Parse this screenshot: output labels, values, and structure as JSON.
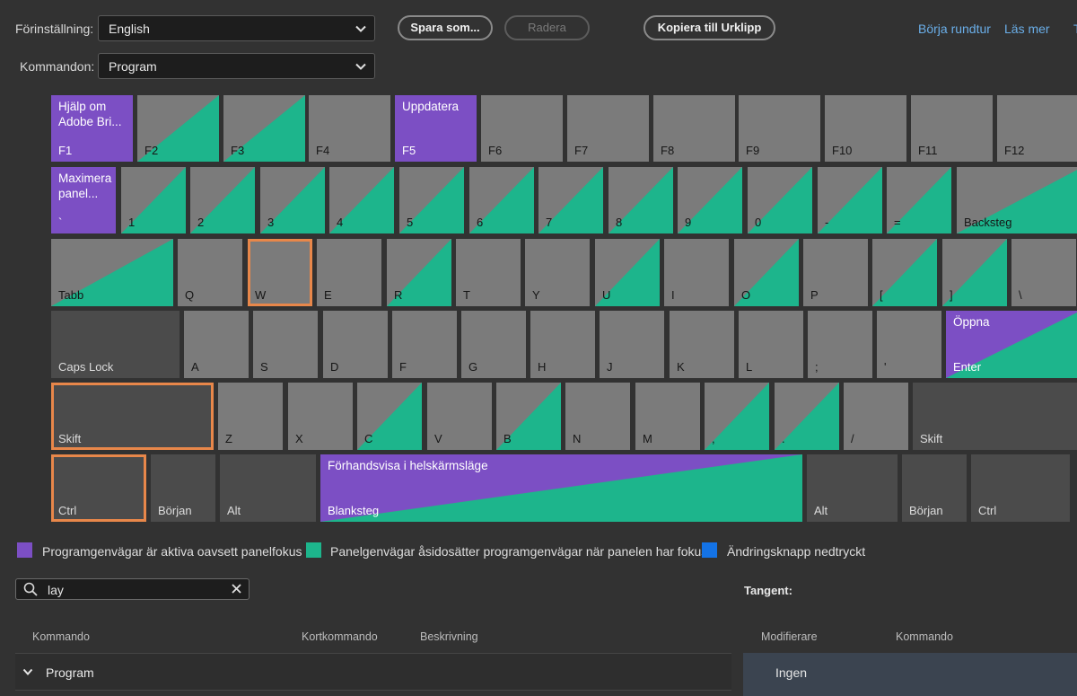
{
  "toolbar": {
    "preset_label": "Förinställning:",
    "preset_value": "English",
    "commands_label": "Kommandon:",
    "commands_value": "Program",
    "save_as": "Spara som...",
    "delete": "Radera",
    "copy": "Kopiera till Urklipp",
    "tour": "Börja rundtur",
    "learn_more": "Läs mer",
    "truncated": "T"
  },
  "colors": {
    "app_shortcut": "#7c4fc4",
    "panel_shortcut": "#1db58c",
    "modifier": "#1473e6",
    "selected_outline": "#e8874a"
  },
  "keyboard": [
    [
      {
        "label": "F1",
        "type": "purple",
        "cmd": "Hjälp om Adobe Bri..."
      },
      {
        "label": "F2",
        "type": "teal"
      },
      {
        "label": "F3",
        "type": "teal"
      },
      {
        "label": "F4",
        "type": "plain"
      },
      {
        "label": "F5",
        "type": "purple",
        "cmd": "Uppdatera"
      },
      {
        "label": "F6",
        "type": "plain"
      },
      {
        "label": "F7",
        "type": "plain"
      },
      {
        "label": "F8",
        "type": "plain"
      },
      {
        "label": "F9",
        "type": "plain"
      },
      {
        "label": "F10",
        "type": "plain"
      },
      {
        "label": "F11",
        "type": "plain"
      },
      {
        "label": "F12",
        "type": "plain"
      }
    ],
    [
      {
        "label": "`",
        "type": "purple",
        "cmd": "Maximera panel..."
      },
      {
        "label": "1",
        "type": "teal"
      },
      {
        "label": "2",
        "type": "teal"
      },
      {
        "label": "3",
        "type": "teal"
      },
      {
        "label": "4",
        "type": "teal"
      },
      {
        "label": "5",
        "type": "teal"
      },
      {
        "label": "6",
        "type": "teal"
      },
      {
        "label": "7",
        "type": "teal"
      },
      {
        "label": "8",
        "type": "teal"
      },
      {
        "label": "9",
        "type": "teal"
      },
      {
        "label": "0",
        "type": "teal"
      },
      {
        "label": "-",
        "type": "teal"
      },
      {
        "label": "=",
        "type": "teal"
      },
      {
        "label": "Backsteg",
        "type": "teal"
      }
    ],
    [
      {
        "label": "Tabb",
        "type": "teal"
      },
      {
        "label": "Q",
        "type": "plain"
      },
      {
        "label": "W",
        "type": "plain",
        "selected": true
      },
      {
        "label": "E",
        "type": "plain"
      },
      {
        "label": "R",
        "type": "teal"
      },
      {
        "label": "T",
        "type": "plain"
      },
      {
        "label": "Y",
        "type": "plain"
      },
      {
        "label": "U",
        "type": "teal"
      },
      {
        "label": "I",
        "type": "plain"
      },
      {
        "label": "O",
        "type": "teal"
      },
      {
        "label": "P",
        "type": "plain"
      },
      {
        "label": "[",
        "type": "teal"
      },
      {
        "label": "]",
        "type": "teal"
      },
      {
        "label": "\\",
        "type": "plain"
      }
    ],
    [
      {
        "label": "Caps Lock",
        "type": "dark"
      },
      {
        "label": "A",
        "type": "plain"
      },
      {
        "label": "S",
        "type": "plain"
      },
      {
        "label": "D",
        "type": "plain"
      },
      {
        "label": "F",
        "type": "plain"
      },
      {
        "label": "G",
        "type": "plain"
      },
      {
        "label": "H",
        "type": "plain"
      },
      {
        "label": "J",
        "type": "plain"
      },
      {
        "label": "K",
        "type": "plain"
      },
      {
        "label": "L",
        "type": "plain"
      },
      {
        "label": ";",
        "type": "plain"
      },
      {
        "label": "'",
        "type": "plain"
      },
      {
        "label": "Enter",
        "type": "pt",
        "cmd": "Öppna"
      }
    ],
    [
      {
        "label": "Skift",
        "type": "dark",
        "selected": true
      },
      {
        "label": "Z",
        "type": "plain"
      },
      {
        "label": "X",
        "type": "plain"
      },
      {
        "label": "C",
        "type": "teal"
      },
      {
        "label": "V",
        "type": "plain"
      },
      {
        "label": "B",
        "type": "teal"
      },
      {
        "label": "N",
        "type": "plain"
      },
      {
        "label": "M",
        "type": "plain"
      },
      {
        "label": ",",
        "type": "teal"
      },
      {
        "label": ".",
        "type": "teal"
      },
      {
        "label": "/",
        "type": "plain"
      },
      {
        "label": "Skift",
        "type": "dark"
      }
    ],
    [
      {
        "label": "Ctrl",
        "type": "dark",
        "selected": true
      },
      {
        "label": "Början",
        "type": "dark"
      },
      {
        "label": "Alt",
        "type": "dark"
      },
      {
        "label": "Blanksteg",
        "type": "pt",
        "cmd": "Förhandsvisa i helskärmsläge"
      },
      {
        "label": "Alt",
        "type": "dark"
      },
      {
        "label": "Början",
        "type": "dark"
      },
      {
        "label": "Ctrl",
        "type": "dark"
      }
    ]
  ],
  "legend": {
    "app": "Programgenvägar är aktiva oavsett panelfokus",
    "panel": "Panelgenvägar åsidosätter programgenvägar när panelen har fokus",
    "modifier": "Ändringsknapp nedtryckt"
  },
  "search": {
    "value": "lay"
  },
  "key_panel": {
    "title": "Tangent:"
  },
  "table": {
    "col_command": "Kommando",
    "col_shortcut": "Kortkommando",
    "col_description": "Beskrivning",
    "group": "Program"
  },
  "modifier_table": {
    "col_modifier": "Modifierare",
    "col_command": "Kommando",
    "row": "Ingen"
  }
}
